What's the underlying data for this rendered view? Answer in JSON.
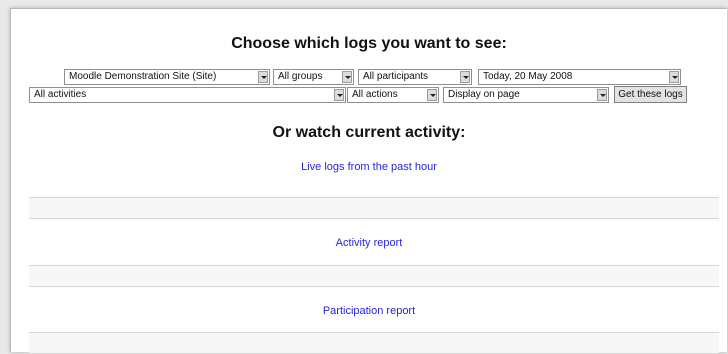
{
  "heading": "Choose which logs you want to see:",
  "filters": {
    "site": "Moodle Demonstration Site (Site)",
    "groups": "All groups",
    "participants": "All participants",
    "date": "Today, 20 May 2008",
    "activities": "All activities",
    "actions": "All actions",
    "display": "Display on page"
  },
  "get_logs_label": "Get these logs",
  "watch_heading": "Or watch current activity:",
  "links": {
    "live_logs": "Live logs from the past hour",
    "activity_report": "Activity report",
    "participation_report": "Participation report"
  }
}
